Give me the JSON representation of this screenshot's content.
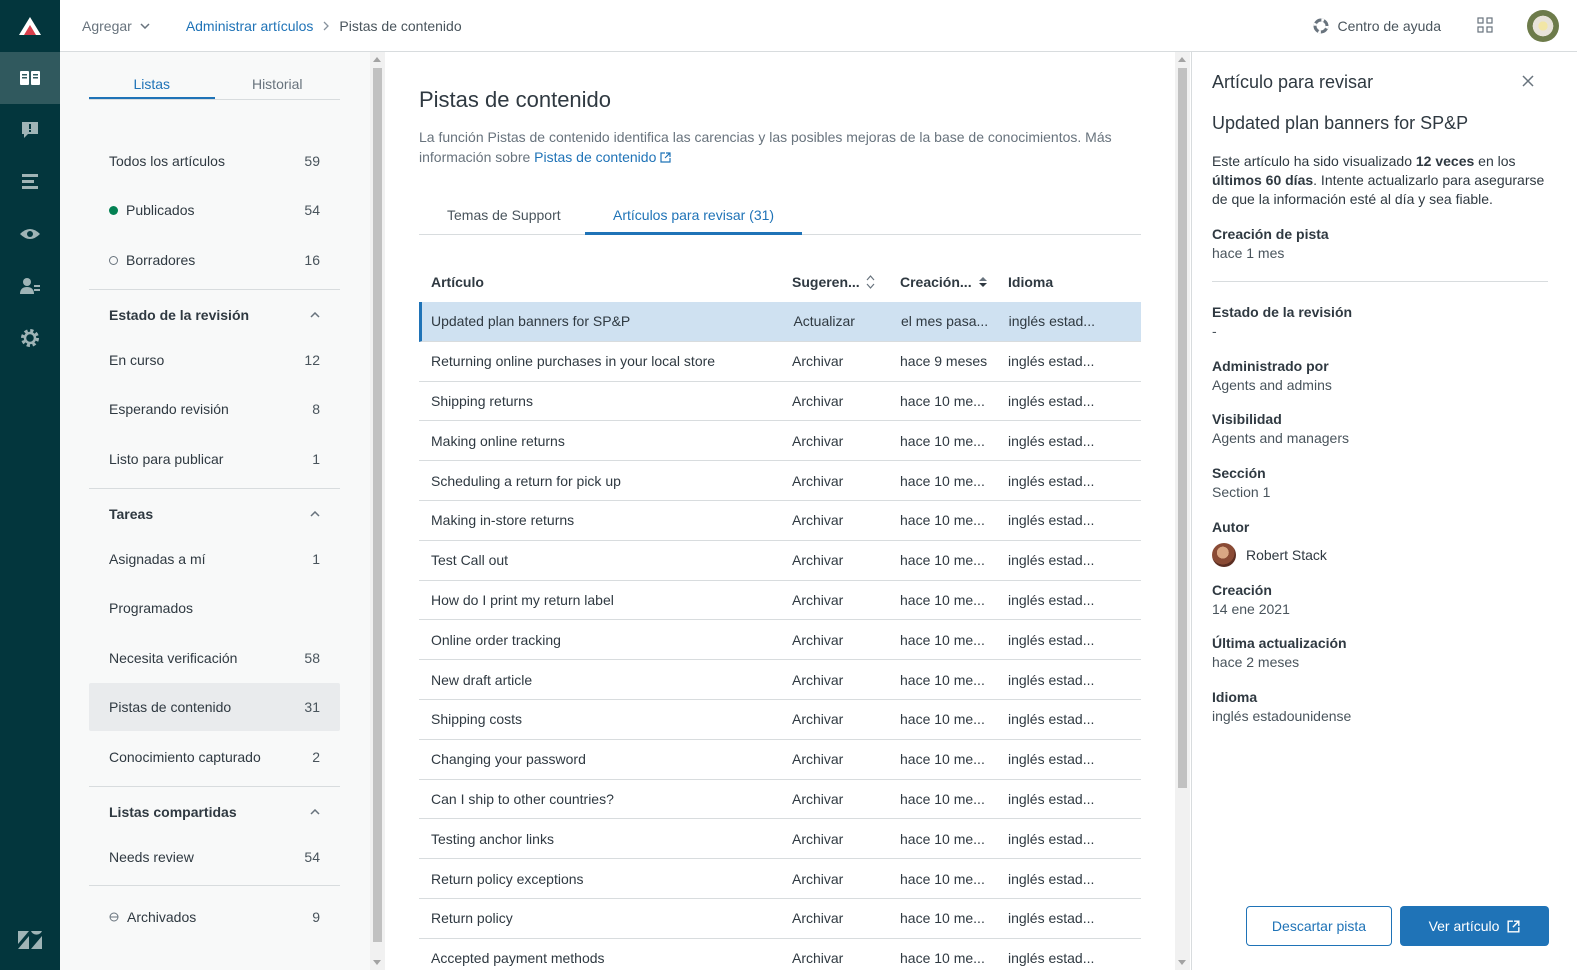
{
  "colors": {
    "rail": "#03363d",
    "accent": "#1f73b7",
    "selected_row": "#cfe1f1",
    "published_dot": "#038153"
  },
  "topbar": {
    "add_label": "Agregar",
    "breadcrumb": {
      "parent": "Administrar artículos",
      "current": "Pistas de contenido"
    },
    "help_label": "Centro de ayuda"
  },
  "left": {
    "tabs": [
      "Listas",
      "Historial"
    ],
    "lists": [
      {
        "label": "Todos los artículos",
        "count": "59"
      },
      {
        "label": "Publicados",
        "count": "54"
      },
      {
        "label": "Borradores",
        "count": "16"
      }
    ],
    "review": {
      "title": "Estado de la revisión",
      "items": [
        {
          "label": "En curso",
          "count": "12"
        },
        {
          "label": "Esperando revisión",
          "count": "8"
        },
        {
          "label": "Listo para publicar",
          "count": "1"
        }
      ]
    },
    "tasks": {
      "title": "Tareas",
      "items": [
        {
          "label": "Asignadas a mí",
          "count": "1"
        },
        {
          "label": "Programados",
          "count": ""
        },
        {
          "label": "Necesita verificación",
          "count": "58"
        },
        {
          "label": "Pistas de contenido",
          "count": "31"
        },
        {
          "label": "Conocimiento capturado",
          "count": "2"
        }
      ]
    },
    "shared": {
      "title": "Listas compartidas",
      "items": [
        {
          "label": "Needs review",
          "count": "54"
        }
      ]
    },
    "archived": {
      "label": "Archivados",
      "count": "9"
    }
  },
  "main": {
    "title": "Pistas de contenido",
    "description": "La función Pistas de contenido identifica las carencias y las posibles mejoras de la base de conocimientos. Más información sobre ",
    "description_link": "Pistas de contenido",
    "tabs": [
      "Temas de Support",
      "Artículos para revisar (31)"
    ],
    "columns": [
      "Artículo",
      "Sugeren...",
      "Creación...",
      "Idioma"
    ],
    "rows": [
      [
        "Updated plan banners for SP&P",
        "Actualizar",
        "el mes pasa...",
        "inglés estad..."
      ],
      [
        "Returning online purchases in your local store",
        "Archivar",
        "hace 9 meses",
        "inglés estad..."
      ],
      [
        "Shipping returns",
        "Archivar",
        "hace 10 me...",
        "inglés estad..."
      ],
      [
        "Making online returns",
        "Archivar",
        "hace 10 me...",
        "inglés estad..."
      ],
      [
        "Scheduling a return for pick up",
        "Archivar",
        "hace 10 me...",
        "inglés estad..."
      ],
      [
        "Making in-store returns",
        "Archivar",
        "hace 10 me...",
        "inglés estad..."
      ],
      [
        "Test Call out",
        "Archivar",
        "hace 10 me...",
        "inglés estad..."
      ],
      [
        "How do I print my return label",
        "Archivar",
        "hace 10 me...",
        "inglés estad..."
      ],
      [
        "Online order tracking",
        "Archivar",
        "hace 10 me...",
        "inglés estad..."
      ],
      [
        "New draft article",
        "Archivar",
        "hace 10 me...",
        "inglés estad..."
      ],
      [
        "Shipping costs",
        "Archivar",
        "hace 10 me...",
        "inglés estad..."
      ],
      [
        "Changing your password",
        "Archivar",
        "hace 10 me...",
        "inglés estad..."
      ],
      [
        "Can I ship to other countries?",
        "Archivar",
        "hace 10 me...",
        "inglés estad..."
      ],
      [
        "Testing anchor links",
        "Archivar",
        "hace 10 me...",
        "inglés estad..."
      ],
      [
        "Return policy exceptions",
        "Archivar",
        "hace 10 me...",
        "inglés estad..."
      ],
      [
        "Return policy",
        "Archivar",
        "hace 10 me...",
        "inglés estad..."
      ],
      [
        "Accepted payment methods",
        "Archivar",
        "hace 10 me...",
        "inglés estad..."
      ]
    ]
  },
  "panel": {
    "title": "Artículo para revisar",
    "article": "Updated plan banners for SP&P",
    "desc_1": "Este artículo ha sido visualizado ",
    "desc_bold_1": "12 veces",
    "desc_2": " en los ",
    "desc_bold_2": "últimos 60 días",
    "desc_3": ". Intente actualizarlo para asegurarse de que la información esté al día y sea fiable.",
    "fields": {
      "created_hint": {
        "k": "Creación de pista",
        "v": "hace 1 mes"
      },
      "review_status": {
        "k": "Estado de la revisión",
        "v": "-"
      },
      "managed_by": {
        "k": "Administrado por",
        "v": "Agents and admins"
      },
      "visibility": {
        "k": "Visibilidad",
        "v": "Agents and managers"
      },
      "section": {
        "k": "Sección",
        "v": "Section 1"
      },
      "author": {
        "k": "Autor",
        "v": "Robert Stack"
      },
      "created": {
        "k": "Creación",
        "v": "14 ene 2021"
      },
      "updated": {
        "k": "Última actualización",
        "v": "hace 2 meses"
      },
      "language": {
        "k": "Idioma",
        "v": "inglés estadounidense"
      }
    },
    "dismiss_label": "Descartar pista",
    "view_label": "Ver artículo"
  }
}
